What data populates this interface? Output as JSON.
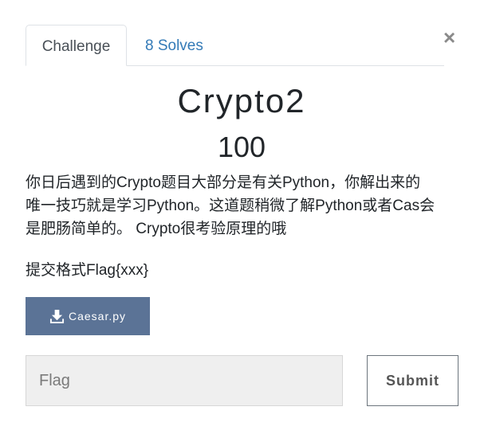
{
  "tabs": {
    "challenge_label": "Challenge",
    "solves_label": "8 Solves"
  },
  "close_glyph": "×",
  "challenge": {
    "name": "Crypto2",
    "value": "100",
    "description_lines": [
      "你日后遇到的Crypto题目大部分是有关Python，你解出来的",
      "唯一技巧就是学习Python。这道题稍微了解Python或者Cas会",
      "是肥肠简单的。 Crypto很考验原理的哦"
    ],
    "flag_format": "提交格式Flag{xxx}",
    "file_label": "Caesar.py"
  },
  "form": {
    "flag_placeholder": "Flag",
    "flag_value": "",
    "submit_label": "Submit"
  },
  "colors": {
    "file_button": "#5b7396",
    "link": "#337ab7",
    "input_bg": "#efefef"
  },
  "icons": {
    "download": "download-icon",
    "close": "close-icon"
  }
}
